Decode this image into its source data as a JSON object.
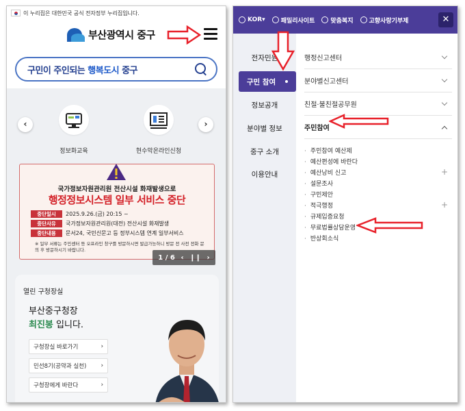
{
  "left": {
    "gov_notice": "이 누리집은 대한민국 공식 전자정부 누리집입니다.",
    "logo_text": "부산광역시 중구",
    "search": {
      "slogan_prefix": "구민이 주인되는 ",
      "slogan_strong": "행복도시",
      "slogan_suffix": " 중구"
    },
    "services": [
      {
        "label": "정보화교육",
        "icon": "monitor-icon"
      },
      {
        "label": "현수막온라인신청",
        "icon": "banner-icon"
      }
    ],
    "notice": {
      "subtitle": "국가정보자원관리원 전산시설 화재발생으로",
      "title": "행정정보시스템 일부 서비스 중단",
      "rows": [
        {
          "label": "중단일시",
          "value": "2025.9.26.(금) 20:15 ~"
        },
        {
          "label": "중단사유",
          "value": "국가정보자원관리원(대전) 전산시설 화재발생"
        },
        {
          "label": "중단내용",
          "value": "문서24, 국민신문고 등 정부시스템 연계 일부서비스"
        }
      ],
      "foot": "※ 일부 서류는 주민센터 등 오프라인 창구를 방문하시면 발급가능하니 방문 전 사전 전화 문의 후 방문하시기 바랍니다."
    },
    "pager": {
      "current": "1",
      "sep": "/",
      "total": "6"
    },
    "office": {
      "tag": "열린 구청장실",
      "name": "부산중구청장",
      "person": "최진봉",
      "person_suffix": " 입니다.",
      "buttons": [
        "구청장실 바로가기",
        "민선8기(공약과 실천)",
        "구청장에게 바란다"
      ]
    }
  },
  "right": {
    "top": {
      "lang": "KOR",
      "family": "패밀리사이트",
      "welfare": "맞춤복지",
      "hometax": "고향사랑기부제"
    },
    "categories": [
      "전자민원",
      "구민 참여",
      "정보공개",
      "분야별 정보",
      "중구 소개",
      "이용안내"
    ],
    "active_category": "구민 참여",
    "menu": [
      "행정신고센터",
      "분야별신고센터",
      "친절·불친절공무원",
      "주민참여"
    ],
    "sub_menu": [
      "주민참여 예산제",
      "예산편성에 바란다",
      "예산낭비 신고",
      "설문조사",
      "구민제안",
      "적극행정",
      "규제입증요청",
      "무료법률상담운영",
      "반상회소식"
    ]
  }
}
